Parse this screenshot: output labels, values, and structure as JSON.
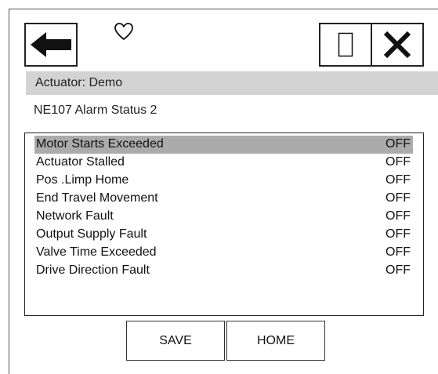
{
  "header": {
    "back_icon": "left-arrow-icon",
    "favorite_icon": "heart-outline-icon",
    "window_icon": "rectangle-icon",
    "close_icon": "close-x-icon"
  },
  "actuator_label": "Actuator: Demo",
  "screen_title": "NE107 Alarm Status 2",
  "alarms": [
    {
      "label": "Motor Starts Exceeded",
      "value": "OFF"
    },
    {
      "label": "Actuator Stalled",
      "value": "OFF"
    },
    {
      "label": "Pos .Limp Home",
      "value": "OFF"
    },
    {
      "label": "End Travel Movement",
      "value": "OFF"
    },
    {
      "label": "Network Fault",
      "value": "OFF"
    },
    {
      "label": "Output Supply Fault",
      "value": "OFF"
    },
    {
      "label": "Valve Time Exceeded",
      "value": "OFF"
    },
    {
      "label": "Drive Direction Fault",
      "value": "OFF"
    }
  ],
  "footer": {
    "save_label": "SAVE",
    "home_label": "HOME"
  },
  "colors": {
    "selected_row": "#ababab",
    "actuator_bar": "#d3d3d3"
  }
}
